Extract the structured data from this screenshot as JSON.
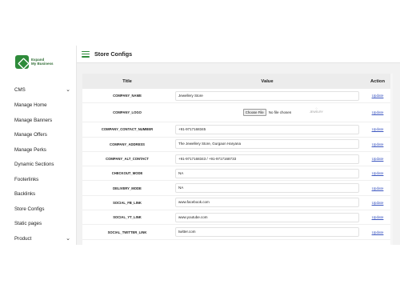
{
  "brand": {
    "line1": "Expand",
    "line2": "My Business"
  },
  "page_title": "Store Configs",
  "sidebar": {
    "items": [
      {
        "label": "CMS",
        "chevron": "chevron-down-icon"
      },
      {
        "label": "Manage Home"
      },
      {
        "label": "Manage Banners"
      },
      {
        "label": "Manage Offers"
      },
      {
        "label": "Manage Perks"
      },
      {
        "label": "Dynamic Sections"
      },
      {
        "label": "Footerlinks"
      },
      {
        "label": "Backlinks"
      },
      {
        "label": "Store Configs"
      },
      {
        "label": "Static pages"
      },
      {
        "label": "Product",
        "chevron": "chevron-down-icon"
      }
    ]
  },
  "table": {
    "headers": {
      "title": "Title",
      "value": "Value",
      "action": "Action"
    },
    "action_label": "Update",
    "logo_row": {
      "key": "COMPANY_LOGO",
      "file_button": "Choose File",
      "file_status": "No file chosen",
      "thumb_text": "JEWELRY"
    },
    "rows": [
      {
        "key": "COMPANY_NAME",
        "value": "Jewellery Store"
      },
      {
        "key": "COMPANY_CONTACT_NUMBER",
        "value": "+91-9717168345"
      },
      {
        "key": "COMPANY_ADDRESS",
        "value": "The Jewellery Store, Gurgaon Haryana"
      },
      {
        "key": "COMPANY_ALT_CONTACT",
        "value": "+91-9717168343 / +91-9717168733"
      },
      {
        "key": "CHECKOUT_MODE",
        "value": "NA"
      },
      {
        "key": "DELIVERY_MODE",
        "value": "NA"
      },
      {
        "key": "SOCIAL_FB_LINK",
        "value": "www.facebook.com"
      },
      {
        "key": "SOCIAL_YT_LINK",
        "value": "www.youtube.com"
      },
      {
        "key": "SOCIAL_TWITTER_LINK",
        "value": "twitter.com"
      }
    ]
  },
  "colors": {
    "accent": "#2e8b3a",
    "link": "#3a55c0",
    "header_bg": "#ececec",
    "page_bg": "#f2f2f2"
  }
}
